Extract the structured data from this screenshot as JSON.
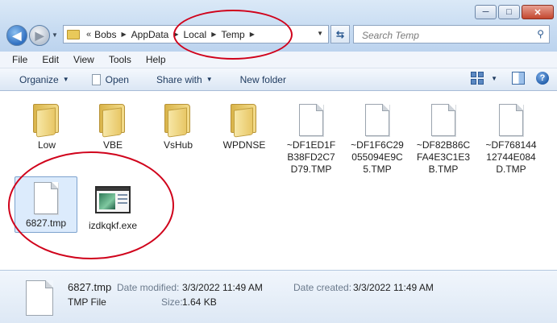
{
  "window": {
    "caption_buttons": {
      "minimize": "─",
      "maximize": "□",
      "close": "✕"
    }
  },
  "nav": {
    "back_glyph": "◀",
    "forward_glyph": "▶"
  },
  "address": {
    "overflow": "«",
    "crumbs": [
      "Bobs",
      "AppData",
      "Local",
      "Temp"
    ]
  },
  "search": {
    "placeholder": "Search Temp"
  },
  "menubar": [
    "File",
    "Edit",
    "View",
    "Tools",
    "Help"
  ],
  "toolbar": {
    "organize": "Organize",
    "open": "Open",
    "share_with": "Share with",
    "new_folder": "New folder"
  },
  "items": [
    {
      "name": "Low",
      "type": "folder"
    },
    {
      "name": "VBE",
      "type": "folder"
    },
    {
      "name": "VsHub",
      "type": "folder"
    },
    {
      "name": "WPDNSE",
      "type": "folder"
    },
    {
      "name": "~DF1ED1FB38FD2C7D79.TMP",
      "type": "file"
    },
    {
      "name": "~DF1F6C29055094E9C5.TMP",
      "type": "file"
    },
    {
      "name": "~DF82B86CFA4E3C1E3B.TMP",
      "type": "file"
    },
    {
      "name": "~DF76814412744E084D.TMP",
      "type": "file"
    },
    {
      "name": "6827.tmp",
      "type": "file",
      "selected": true
    },
    {
      "name": "izdkqkf.exe",
      "type": "exe"
    }
  ],
  "details": {
    "name": "6827.tmp",
    "type": "TMP File",
    "date_modified_label": "Date modified:",
    "date_modified": "3/3/2022 11:49 AM",
    "size_label": "Size:",
    "size": "1.64 KB",
    "date_created_label": "Date created:",
    "date_created": "3/3/2022 11:49 AM"
  },
  "colors": {
    "annotation": "#d0021b",
    "selection": "#dcebfc"
  }
}
